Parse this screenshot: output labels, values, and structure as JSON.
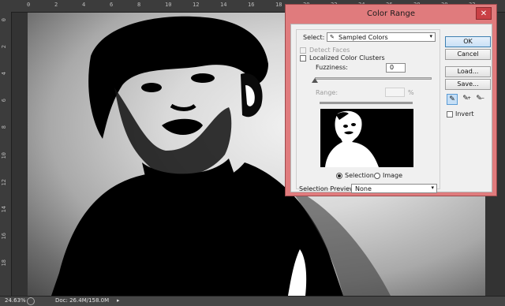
{
  "rulers": {
    "top": [
      "0",
      "2",
      "4",
      "6",
      "8",
      "10",
      "12",
      "14",
      "16",
      "18",
      "20",
      "22",
      "24",
      "26",
      "28",
      "30",
      "32"
    ],
    "left": [
      "0",
      "2",
      "4",
      "6",
      "8",
      "10",
      "12",
      "14",
      "16",
      "18"
    ]
  },
  "status": {
    "zoom": "24.63%",
    "doc": "Doc: 26.4M/158.0M",
    "arrow": "▸"
  },
  "dialog": {
    "title": "Color Range",
    "close_glyph": "✕",
    "select_label": "Select:",
    "select_value": "Sampled Colors",
    "detect_faces": "Detect Faces",
    "localized_clusters": "Localized Color Clusters",
    "fuzziness_label": "Fuzziness:",
    "fuzziness_value": "0",
    "range_label": "Range:",
    "range_unit": "%",
    "preview_mode_selection": "Selection",
    "preview_mode_image": "Image",
    "selection_preview_label": "Selection Preview:",
    "selection_preview_value": "None",
    "buttons": {
      "ok": "OK",
      "cancel": "Cancel",
      "load": "Load...",
      "save": "Save..."
    },
    "invert_label": "Invert",
    "fuzziness_slider_level": 0
  },
  "icons": [
    "eyedropper-icon",
    "eyedropper-plus-icon",
    "eyedropper-minus-icon",
    "chevron-down-icon",
    "close-icon"
  ]
}
